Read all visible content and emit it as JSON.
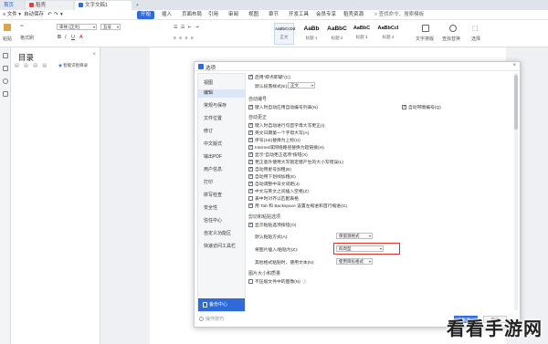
{
  "tabs": [
    {
      "label": "首页"
    },
    {
      "label": "稻壳"
    },
    {
      "label": "文字文稿1"
    }
  ],
  "menubar": {
    "left": [
      "≡ 文件 ▾",
      "自动保存",
      "↶",
      "↷",
      "▾"
    ],
    "items": [
      "开始",
      "插入",
      "页面布局",
      "引用",
      "审阅",
      "视图",
      "章节",
      "开发工具",
      "会员专享",
      "稻壳资源"
    ],
    "search": "查找命令、搜索模板"
  },
  "ribbon": {
    "paste": "粘贴",
    "format_painter": "格式刷",
    "font_name": "宋体 (正文)",
    "font_size": "五号",
    "styles": [
      {
        "preview": "AaBbCcDd",
        "name": "正文"
      },
      {
        "preview": "AaBb",
        "name": "标题 1"
      },
      {
        "preview": "AaBbC",
        "name": "标题 2"
      },
      {
        "preview": "AaBbC",
        "name": "标题 3"
      },
      {
        "preview": "AaBbCcI",
        "name": "标题 4"
      }
    ],
    "text_layout": "文字排版",
    "find_replace": "查找替换",
    "select": "选择"
  },
  "toc": {
    "title": "目录",
    "close": "×",
    "item": "智能识别目录"
  },
  "dialog": {
    "title": "选项",
    "close": "×",
    "nav": [
      "视图",
      "编辑",
      "常规与保存",
      "文件位置",
      "修订",
      "中文版式",
      "输出PDF",
      "用户信息",
      "打印",
      "拼写检查",
      "安全性",
      "信任中心",
      "自定义功能区",
      "快速访问工具栏"
    ],
    "nav_selected": "编辑",
    "backup_center": "备份中心",
    "tips": "操作技巧",
    "top_checkbox": "启用\"即点即输\"(C)",
    "default_style_label": "默认段落样式(E):",
    "default_style_value": "正文",
    "sections": {
      "numbering": "自动编号",
      "autocorrect": "自动更正",
      "paste": "剪切和粘贴选项",
      "image": "图片大小和质量"
    },
    "numbering_checkbox": "键入时自动应用自动编号列表(N)",
    "numbering_checkbox_right": "自动带圈编号(Q)",
    "autocorrect_items": [
      "键入时自动进行句首字母大写更正(I)",
      "英文日期第一个字母大写(A)",
      "序号(1st)替换为上标(U)",
      "Internet或网络路径替换为超链接(H)",
      "显示\"自动更正选项\"按钮(X)",
      "更正意外使用大写锁定键产生的大小写错误(L)",
      "自动用星号加粗(B)",
      "自动用下划线加粗(E)",
      "自动调整中日文间距(J)",
      "中文与英文之间插入空格(Z)",
      "表中时对齐以匹配表格",
      "用 Tab 和 Backspace 设置左缩进和首行缩进(G)"
    ],
    "paste_checkbox": "显示粘贴选项按钮(O)",
    "paste_rows": [
      {
        "label": "默认粘贴方式(A):",
        "value": "保留源格式"
      },
      {
        "label": "将图片插入/粘贴为(Z):",
        "value": "四周型"
      },
      {
        "label": "其他格式粘贴时，使用文本(N):",
        "value": "使用目标格式"
      }
    ],
    "image_checkbox": "不压缩文件中的图像(N)",
    "ok": "确定",
    "cancel": "取消"
  },
  "watermark": "看看手游网"
}
